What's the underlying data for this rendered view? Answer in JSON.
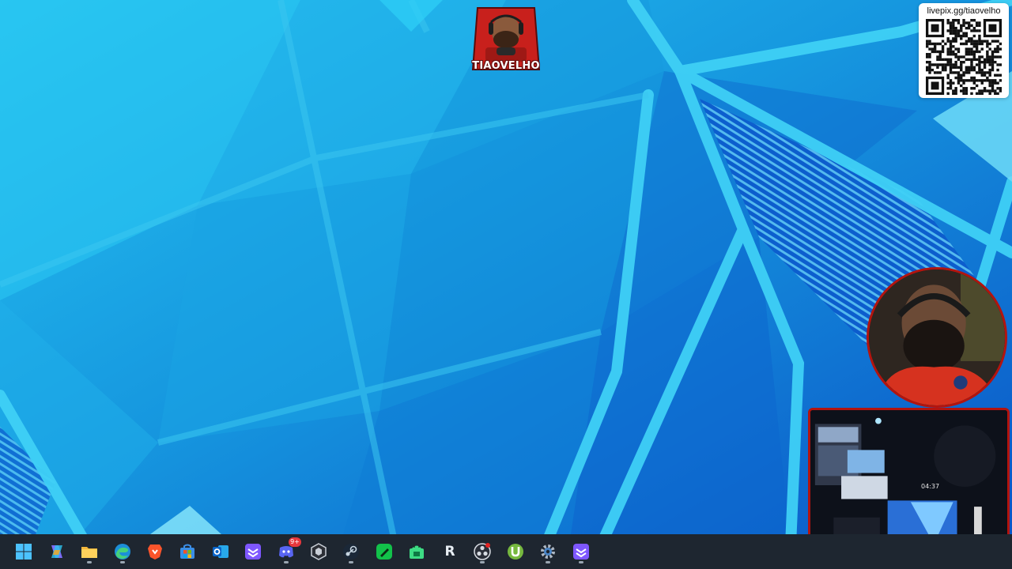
{
  "overlay": {
    "logo_name": "TIAOVELHO",
    "qr_caption": "livepix.gg/tiaovelho"
  },
  "room_cam": {
    "clock": "04:37"
  },
  "taskbar": {
    "items": [
      {
        "name": "start",
        "icon": "windows-start-icon"
      },
      {
        "name": "copilot",
        "icon": "copilot-icon"
      },
      {
        "name": "file-explorer",
        "icon": "folder-icon"
      },
      {
        "name": "edge",
        "icon": "edge-browser-icon"
      },
      {
        "name": "brave",
        "icon": "brave-browser-icon"
      },
      {
        "name": "store",
        "icon": "microsoft-store-icon"
      },
      {
        "name": "outlook",
        "icon": "outlook-icon"
      },
      {
        "name": "streaming-app",
        "icon": "streaming-app-icon"
      },
      {
        "name": "discord",
        "icon": "discord-icon",
        "badge": "9+"
      },
      {
        "name": "unity",
        "icon": "unity-icon"
      },
      {
        "name": "steam",
        "icon": "steam-icon"
      },
      {
        "name": "editor",
        "icon": "green-pen-icon"
      },
      {
        "name": "android-studio",
        "icon": "android-icon"
      },
      {
        "name": "r-app",
        "icon": "r-letter-icon",
        "letter": "R"
      },
      {
        "name": "obs",
        "icon": "obs-record-icon"
      },
      {
        "name": "utorrent",
        "icon": "utorrent-icon"
      },
      {
        "name": "settings",
        "icon": "gear-icon"
      },
      {
        "name": "streaming-app-2",
        "icon": "streaming-app-icon"
      }
    ]
  },
  "colors": {
    "wallpaper_base": "#1a9be0",
    "wallpaper_light": "#27c6f2",
    "wallpaper_dark": "#0a55c8",
    "taskbar": "#1e2630",
    "frame_red": "#b3140f"
  }
}
